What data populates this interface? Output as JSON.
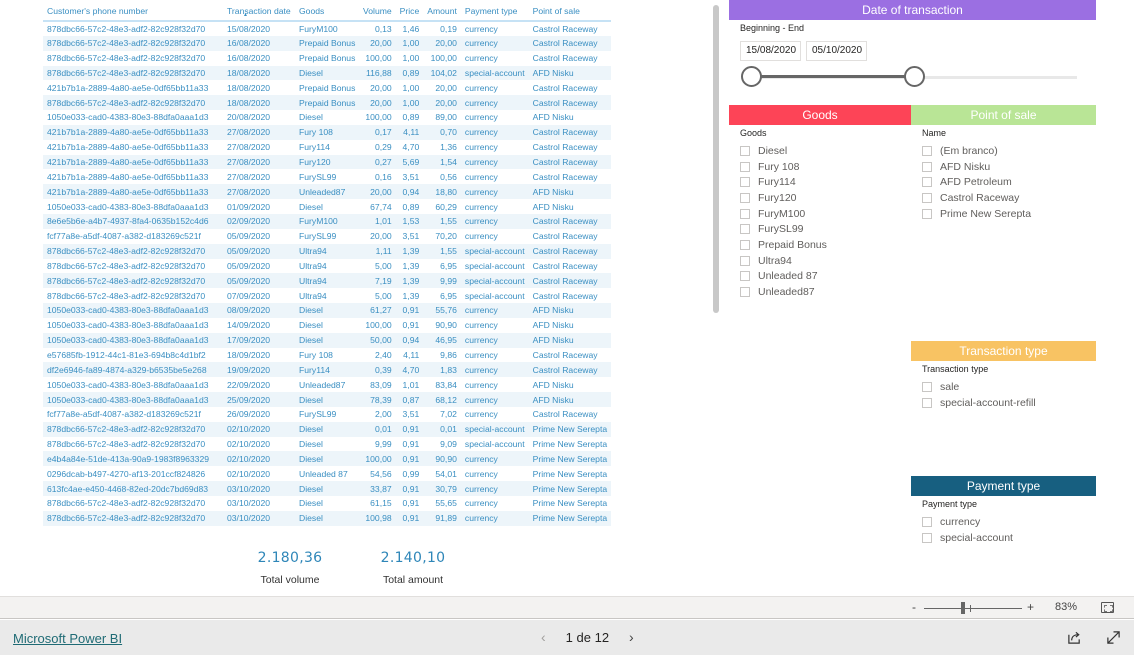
{
  "table": {
    "headers": [
      "Customer's phone number",
      "Transaction date",
      "Goods",
      "Volume",
      "Price",
      "Amount",
      "Payment type",
      "Point of sale"
    ],
    "sort_indicator": "ascending",
    "rows": [
      [
        "878dbc66-57c2-48e3-adf2-82c928f32d70",
        "15/08/2020",
        "FuryM100",
        "0,13",
        "1,46",
        "0,19",
        "currency",
        "Castrol Raceway"
      ],
      [
        "878dbc66-57c2-48e3-adf2-82c928f32d70",
        "16/08/2020",
        "Prepaid Bonus",
        "20,00",
        "1,00",
        "20,00",
        "currency",
        "Castrol Raceway"
      ],
      [
        "878dbc66-57c2-48e3-adf2-82c928f32d70",
        "16/08/2020",
        "Prepaid Bonus",
        "100,00",
        "1,00",
        "100,00",
        "currency",
        "Castrol Raceway"
      ],
      [
        "878dbc66-57c2-48e3-adf2-82c928f32d70",
        "18/08/2020",
        "Diesel",
        "116,88",
        "0,89",
        "104,02",
        "special-account",
        "AFD Nisku"
      ],
      [
        "421b7b1a-2889-4a80-ae5e-0df65bb11a33",
        "18/08/2020",
        "Prepaid Bonus",
        "20,00",
        "1,00",
        "20,00",
        "currency",
        "Castrol Raceway"
      ],
      [
        "878dbc66-57c2-48e3-adf2-82c928f32d70",
        "18/08/2020",
        "Prepaid Bonus",
        "20,00",
        "1,00",
        "20,00",
        "currency",
        "Castrol Raceway"
      ],
      [
        "1050e033-cad0-4383-80e3-88dfa0aaa1d3",
        "20/08/2020",
        "Diesel",
        "100,00",
        "0,89",
        "89,00",
        "currency",
        "AFD Nisku"
      ],
      [
        "421b7b1a-2889-4a80-ae5e-0df65bb11a33",
        "27/08/2020",
        "Fury 108",
        "0,17",
        "4,11",
        "0,70",
        "currency",
        "Castrol Raceway"
      ],
      [
        "421b7b1a-2889-4a80-ae5e-0df65bb11a33",
        "27/08/2020",
        "Fury114",
        "0,29",
        "4,70",
        "1,36",
        "currency",
        "Castrol Raceway"
      ],
      [
        "421b7b1a-2889-4a80-ae5e-0df65bb11a33",
        "27/08/2020",
        "Fury120",
        "0,27",
        "5,69",
        "1,54",
        "currency",
        "Castrol Raceway"
      ],
      [
        "421b7b1a-2889-4a80-ae5e-0df65bb11a33",
        "27/08/2020",
        "FurySL99",
        "0,16",
        "3,51",
        "0,56",
        "currency",
        "Castrol Raceway"
      ],
      [
        "421b7b1a-2889-4a80-ae5e-0df65bb11a33",
        "27/08/2020",
        "Unleaded87",
        "20,00",
        "0,94",
        "18,80",
        "currency",
        "AFD Nisku"
      ],
      [
        "1050e033-cad0-4383-80e3-88dfa0aaa1d3",
        "01/09/2020",
        "Diesel",
        "67,74",
        "0,89",
        "60,29",
        "currency",
        "AFD Nisku"
      ],
      [
        "8e6e5b6e-a4b7-4937-8fa4-0635b152c4d6",
        "02/09/2020",
        "FuryM100",
        "1,01",
        "1,53",
        "1,55",
        "currency",
        "Castrol Raceway"
      ],
      [
        "fcf77a8e-a5df-4087-a382-d183269c521f",
        "05/09/2020",
        "FurySL99",
        "20,00",
        "3,51",
        "70,20",
        "currency",
        "Castrol Raceway"
      ],
      [
        "878dbc66-57c2-48e3-adf2-82c928f32d70",
        "05/09/2020",
        "Ultra94",
        "1,11",
        "1,39",
        "1,55",
        "special-account",
        "Castrol Raceway"
      ],
      [
        "878dbc66-57c2-48e3-adf2-82c928f32d70",
        "05/09/2020",
        "Ultra94",
        "5,00",
        "1,39",
        "6,95",
        "special-account",
        "Castrol Raceway"
      ],
      [
        "878dbc66-57c2-48e3-adf2-82c928f32d70",
        "05/09/2020",
        "Ultra94",
        "7,19",
        "1,39",
        "9,99",
        "special-account",
        "Castrol Raceway"
      ],
      [
        "878dbc66-57c2-48e3-adf2-82c928f32d70",
        "07/09/2020",
        "Ultra94",
        "5,00",
        "1,39",
        "6,95",
        "special-account",
        "Castrol Raceway"
      ],
      [
        "1050e033-cad0-4383-80e3-88dfa0aaa1d3",
        "08/09/2020",
        "Diesel",
        "61,27",
        "0,91",
        "55,76",
        "currency",
        "AFD Nisku"
      ],
      [
        "1050e033-cad0-4383-80e3-88dfa0aaa1d3",
        "14/09/2020",
        "Diesel",
        "100,00",
        "0,91",
        "90,90",
        "currency",
        "AFD Nisku"
      ],
      [
        "1050e033-cad0-4383-80e3-88dfa0aaa1d3",
        "17/09/2020",
        "Diesel",
        "50,00",
        "0,94",
        "46,95",
        "currency",
        "AFD Nisku"
      ],
      [
        "e57685fb-1912-44c1-81e3-694b8c4d1bf2",
        "18/09/2020",
        "Fury 108",
        "2,40",
        "4,11",
        "9,86",
        "currency",
        "Castrol Raceway"
      ],
      [
        "df2e6946-fa89-4874-a329-b6535be5e268",
        "19/09/2020",
        "Fury114",
        "0,39",
        "4,70",
        "1,83",
        "currency",
        "Castrol Raceway"
      ],
      [
        "1050e033-cad0-4383-80e3-88dfa0aaa1d3",
        "22/09/2020",
        "Unleaded87",
        "83,09",
        "1,01",
        "83,84",
        "currency",
        "AFD Nisku"
      ],
      [
        "1050e033-cad0-4383-80e3-88dfa0aaa1d3",
        "25/09/2020",
        "Diesel",
        "78,39",
        "0,87",
        "68,12",
        "currency",
        "AFD Nisku"
      ],
      [
        "fcf77a8e-a5df-4087-a382-d183269c521f",
        "26/09/2020",
        "FurySL99",
        "2,00",
        "3,51",
        "7,02",
        "currency",
        "Castrol Raceway"
      ],
      [
        "878dbc66-57c2-48e3-adf2-82c928f32d70",
        "02/10/2020",
        "Diesel",
        "0,01",
        "0,91",
        "0,01",
        "special-account",
        "Prime New Serepta"
      ],
      [
        "878dbc66-57c2-48e3-adf2-82c928f32d70",
        "02/10/2020",
        "Diesel",
        "9,99",
        "0,91",
        "9,09",
        "special-account",
        "Prime New Serepta"
      ],
      [
        "e4b4a84e-51de-413a-90a9-1983f8963329",
        "02/10/2020",
        "Diesel",
        "100,00",
        "0,91",
        "90,90",
        "currency",
        "Prime New Serepta"
      ],
      [
        "0296dcab-b497-4270-af13-201ccf824826",
        "02/10/2020",
        "Unleaded 87",
        "54,56",
        "0,99",
        "54,01",
        "currency",
        "Prime New Serepta"
      ],
      [
        "613fc4ae-e450-4468-82ed-20dc7bd69d83",
        "03/10/2020",
        "Diesel",
        "33,87",
        "0,91",
        "30,79",
        "currency",
        "Prime New Serepta"
      ],
      [
        "878dbc66-57c2-48e3-adf2-82c928f32d70",
        "03/10/2020",
        "Diesel",
        "61,15",
        "0,91",
        "55,65",
        "currency",
        "Prime New Serepta"
      ],
      [
        "878dbc66-57c2-48e3-adf2-82c928f32d70",
        "03/10/2020",
        "Diesel",
        "100,98",
        "0,91",
        "91,89",
        "currency",
        "Prime New Serepta"
      ]
    ]
  },
  "totals": {
    "volume": {
      "value": "2.180,36",
      "label": "Total volume"
    },
    "amount": {
      "value": "2.140,10",
      "label": "Total amount"
    }
  },
  "date_slicer": {
    "title": "Date of transaction",
    "subtitle": "Beginning - End",
    "start": "15/08/2020",
    "end": "05/10/2020",
    "range_fraction": [
      0.0,
      0.5
    ],
    "color": "#9b6fe2"
  },
  "goods_slicer": {
    "title": "Goods",
    "subtitle": "Goods",
    "color": "#fd4457",
    "options": [
      "Diesel",
      "Fury 108",
      "Fury114",
      "Fury120",
      "FuryM100",
      "FurySL99",
      "Prepaid Bonus",
      "Ultra94",
      "Unleaded 87",
      "Unleaded87"
    ]
  },
  "pos_slicer": {
    "title": "Point of sale",
    "subtitle": "Name",
    "color": "#b9e596",
    "options": [
      "(Em branco)",
      "AFD Nisku",
      "AFD Petroleum",
      "Castrol Raceway",
      "Prime New Serepta"
    ]
  },
  "transaction_type_slicer": {
    "title": "Transaction type",
    "subtitle": "Transaction type",
    "color": "#f8c363",
    "options": [
      "sale",
      "special-account-refill"
    ]
  },
  "payment_type_slicer": {
    "title": "Payment type",
    "subtitle": "Payment type",
    "color": "#175f80",
    "options": [
      "currency",
      "special-account"
    ]
  },
  "zoom": {
    "minus": "-",
    "plus": "+",
    "percent": "83%",
    "level": 0.4
  },
  "footer": {
    "brand": "Microsoft Power BI",
    "page_indicator": "1 de 12",
    "prev": "‹",
    "next": "›"
  }
}
